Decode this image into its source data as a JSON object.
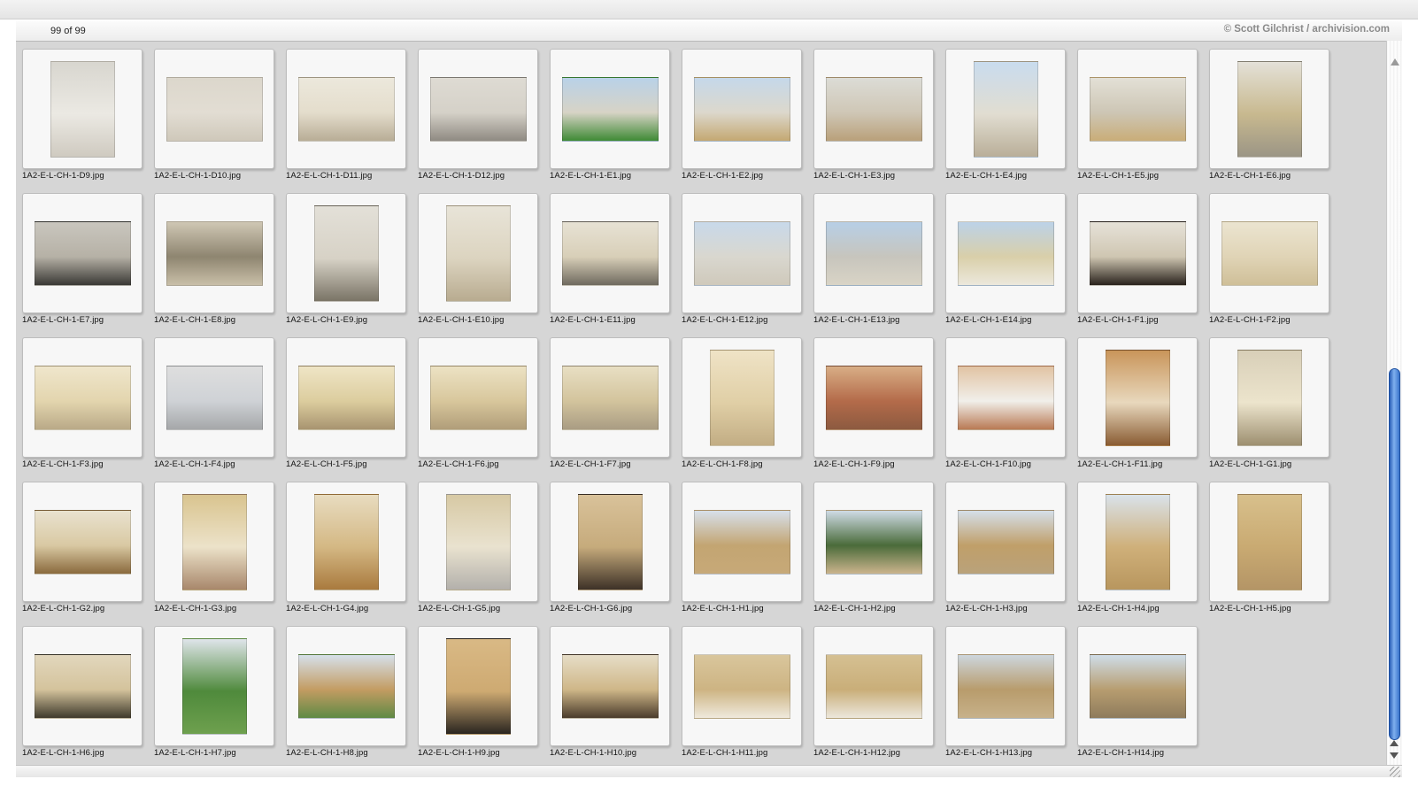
{
  "header": {
    "counter": "99 of 99",
    "credit": "© Scott Gilchrist / archivision.com"
  },
  "thumbnails": [
    {
      "label": "1A2-E-L-CH-1-D9.jpg",
      "orient": "portrait",
      "colors": [
        "#d8d6cf",
        "#ebe9e3",
        "#cfcac0"
      ]
    },
    {
      "label": "1A2-E-L-CH-1-D10.jpg",
      "orient": "landscape",
      "colors": [
        "#dcd7cc",
        "#e2ddd3",
        "#cfc8ba"
      ]
    },
    {
      "label": "1A2-E-L-CH-1-D11.jpg",
      "orient": "landscape",
      "colors": [
        "#ece8dc",
        "#e4ddcc",
        "#b8ad96"
      ]
    },
    {
      "label": "1A2-E-L-CH-1-D12.jpg",
      "orient": "landscape",
      "colors": [
        "#dedbd3",
        "#d5d1c8",
        "#8f8a82"
      ]
    },
    {
      "label": "1A2-E-L-CH-1-E1.jpg",
      "orient": "landscape",
      "colors": [
        "#b9d2e8",
        "#d7d3c6",
        "#3f8a35"
      ]
    },
    {
      "label": "1A2-E-L-CH-1-E2.jpg",
      "orient": "landscape",
      "colors": [
        "#c5d8ea",
        "#dcd8cc",
        "#c4a872"
      ]
    },
    {
      "label": "1A2-E-L-CH-1-E3.jpg",
      "orient": "landscape",
      "colors": [
        "#dcdcd6",
        "#cfc7b6",
        "#b9a07a"
      ]
    },
    {
      "label": "1A2-E-L-CH-1-E4.jpg",
      "orient": "portrait",
      "colors": [
        "#c9dcee",
        "#e1ddd1",
        "#b9ae98"
      ]
    },
    {
      "label": "1A2-E-L-CH-1-E5.jpg",
      "orient": "landscape",
      "colors": [
        "#e3e0d6",
        "#cdc6b5",
        "#c9ad78"
      ]
    },
    {
      "label": "1A2-E-L-CH-1-E6.jpg",
      "orient": "portrait",
      "colors": [
        "#e4e1d8",
        "#c8b98f",
        "#9b9585"
      ]
    },
    {
      "label": "1A2-E-L-CH-1-E7.jpg",
      "orient": "landscape",
      "colors": [
        "#c9c6be",
        "#b6b1a6",
        "#3a3935"
      ]
    },
    {
      "label": "1A2-E-L-CH-1-E8.jpg",
      "orient": "landscape",
      "colors": [
        "#cfc7b4",
        "#8e8570",
        "#c9bfa8"
      ]
    },
    {
      "label": "1A2-E-L-CH-1-E9.jpg",
      "orient": "portrait",
      "colors": [
        "#e3e0d8",
        "#d7d2c6",
        "#7a7466"
      ]
    },
    {
      "label": "1A2-E-L-CH-1-E10.jpg",
      "orient": "portrait",
      "colors": [
        "#e8e4d8",
        "#dcd4c0",
        "#b8ab90"
      ]
    },
    {
      "label": "1A2-E-L-CH-1-E11.jpg",
      "orient": "landscape",
      "colors": [
        "#e7e2d4",
        "#d8cfb8",
        "#6f6a5f"
      ]
    },
    {
      "label": "1A2-E-L-CH-1-E12.jpg",
      "orient": "landscape",
      "colors": [
        "#c8d9ea",
        "#d9d7cf",
        "#cfc9bb"
      ]
    },
    {
      "label": "1A2-E-L-CH-1-E13.jpg",
      "orient": "landscape",
      "colors": [
        "#b7cfe6",
        "#c7c5bd",
        "#d9d4c6"
      ]
    },
    {
      "label": "1A2-E-L-CH-1-E14.jpg",
      "orient": "landscape",
      "colors": [
        "#bcd2e8",
        "#d9cfa9",
        "#ece8dc"
      ]
    },
    {
      "label": "1A2-E-L-CH-1-F1.jpg",
      "orient": "landscape",
      "colors": [
        "#e6e2d8",
        "#cfc6b2",
        "#2a231d"
      ]
    },
    {
      "label": "1A2-E-L-CH-1-F2.jpg",
      "orient": "landscape",
      "colors": [
        "#ebe4d0",
        "#e0d4b6",
        "#cfbf98"
      ]
    },
    {
      "label": "1A2-E-L-CH-1-F3.jpg",
      "orient": "landscape",
      "colors": [
        "#efe6cc",
        "#e3d5ae",
        "#b9a987"
      ]
    },
    {
      "label": "1A2-E-L-CH-1-F4.jpg",
      "orient": "landscape",
      "colors": [
        "#dedede",
        "#cfd2d6",
        "#a5a7a9"
      ]
    },
    {
      "label": "1A2-E-L-CH-1-F5.jpg",
      "orient": "landscape",
      "colors": [
        "#efe5c6",
        "#dccd9e",
        "#a89470"
      ]
    },
    {
      "label": "1A2-E-L-CH-1-F6.jpg",
      "orient": "landscape",
      "colors": [
        "#ece2c4",
        "#d8c79c",
        "#b09d79"
      ]
    },
    {
      "label": "1A2-E-L-CH-1-F7.jpg",
      "orient": "landscape",
      "colors": [
        "#e8dfc3",
        "#d3c49d",
        "#a99c83"
      ]
    },
    {
      "label": "1A2-E-L-CH-1-F8.jpg",
      "orient": "portrait",
      "colors": [
        "#efe3c6",
        "#e0cfa6",
        "#c2ad84"
      ]
    },
    {
      "label": "1A2-E-L-CH-1-F9.jpg",
      "orient": "landscape",
      "colors": [
        "#d8ae86",
        "#b46b4a",
        "#8c5a40"
      ]
    },
    {
      "label": "1A2-E-L-CH-1-F10.jpg",
      "orient": "landscape",
      "colors": [
        "#e1c3a3",
        "#f1efea",
        "#b97a55"
      ]
    },
    {
      "label": "1A2-E-L-CH-1-F11.jpg",
      "orient": "portrait",
      "colors": [
        "#c9955a",
        "#e8d8bd",
        "#8a5c33"
      ]
    },
    {
      "label": "1A2-E-L-CH-1-G1.jpg",
      "orient": "portrait",
      "colors": [
        "#d8cfb8",
        "#ece4cc",
        "#9d8f70"
      ]
    },
    {
      "label": "1A2-E-L-CH-1-G2.jpg",
      "orient": "landscape",
      "colors": [
        "#e9e2cf",
        "#d9c9a3",
        "#8a6a3d"
      ]
    },
    {
      "label": "1A2-E-L-CH-1-G3.jpg",
      "orient": "portrait",
      "colors": [
        "#d9c48f",
        "#ece2c9",
        "#a8876b"
      ]
    },
    {
      "label": "1A2-E-L-CH-1-G4.jpg",
      "orient": "portrait",
      "colors": [
        "#e8dcc0",
        "#d4b884",
        "#a97a3e"
      ]
    },
    {
      "label": "1A2-E-L-CH-1-G5.jpg",
      "orient": "portrait",
      "colors": [
        "#d7c9a4",
        "#e9e2cf",
        "#b3b0ab"
      ]
    },
    {
      "label": "1A2-E-L-CH-1-G6.jpg",
      "orient": "portrait",
      "colors": [
        "#d9c29a",
        "#c6ab7c",
        "#3d3127"
      ]
    },
    {
      "label": "1A2-E-L-CH-1-H1.jpg",
      "orient": "landscape",
      "colors": [
        "#d7e0ea",
        "#c3a572",
        "#c7a978"
      ]
    },
    {
      "label": "1A2-E-L-CH-1-H2.jpg",
      "orient": "landscape",
      "colors": [
        "#cfdbe6",
        "#4a6b3a",
        "#cbb48d"
      ]
    },
    {
      "label": "1A2-E-L-CH-1-H3.jpg",
      "orient": "landscape",
      "colors": [
        "#d5dfe9",
        "#c09f69",
        "#b9a27b"
      ]
    },
    {
      "label": "1A2-E-L-CH-1-H4.jpg",
      "orient": "portrait",
      "colors": [
        "#d9e2ea",
        "#cfb07a",
        "#b8965e"
      ]
    },
    {
      "label": "1A2-E-L-CH-1-H5.jpg",
      "orient": "portrait",
      "colors": [
        "#d8c08c",
        "#c9aa72",
        "#b49566"
      ]
    },
    {
      "label": "1A2-E-L-CH-1-H6.jpg",
      "orient": "landscape",
      "colors": [
        "#e2d7bd",
        "#d4c39c",
        "#3f3a2c"
      ]
    },
    {
      "label": "1A2-E-L-CH-1-H7.jpg",
      "orient": "portrait",
      "colors": [
        "#dfe5ea",
        "#4f8a3c",
        "#6ea04e"
      ]
    },
    {
      "label": "1A2-E-L-CH-1-H8.jpg",
      "orient": "landscape",
      "colors": [
        "#d6e0ea",
        "#c39c62",
        "#5f8a45"
      ]
    },
    {
      "label": "1A2-E-L-CH-1-H9.jpg",
      "orient": "portrait",
      "colors": [
        "#d9b985",
        "#ceaa72",
        "#2a2520"
      ]
    },
    {
      "label": "1A2-E-L-CH-1-H10.jpg",
      "orient": "landscape",
      "colors": [
        "#e6ddc7",
        "#cfb788",
        "#4b3c2c"
      ]
    },
    {
      "label": "1A2-E-L-CH-1-H11.jpg",
      "orient": "landscape",
      "colors": [
        "#d9c69c",
        "#cdb483",
        "#efe9dc"
      ]
    },
    {
      "label": "1A2-E-L-CH-1-H12.jpg",
      "orient": "landscape",
      "colors": [
        "#d5c092",
        "#c9ae79",
        "#ece7dc"
      ]
    },
    {
      "label": "1A2-E-L-CH-1-H13.jpg",
      "orient": "landscape",
      "colors": [
        "#cdd6dd",
        "#b89c6c",
        "#c7b18a"
      ]
    },
    {
      "label": "1A2-E-L-CH-1-H14.jpg",
      "orient": "landscape",
      "colors": [
        "#cfdde8",
        "#b79d70",
        "#8e7b5c"
      ]
    }
  ]
}
